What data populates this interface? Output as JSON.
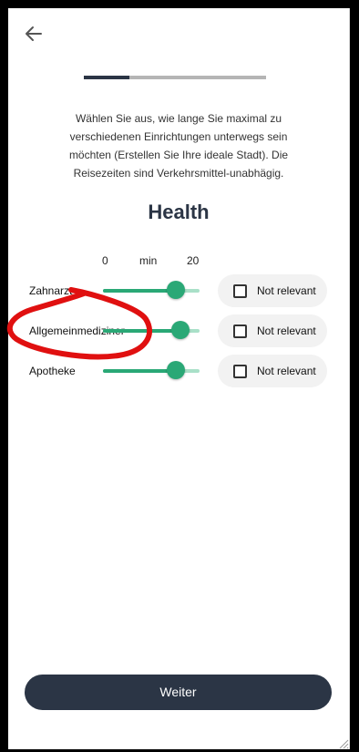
{
  "header": {
    "back_icon": "arrow-left-icon"
  },
  "progress": {
    "value": 0.25
  },
  "intro_text": "Wählen Sie aus, wie lange Sie maximal zu verschiedenen Einrichtungen unterwegs sein möchten (Erstellen Sie Ihre ideale Stadt). Die Reisezeiten sind Verkehrsmittel-unabhägig.",
  "section_title": "Health",
  "scale": {
    "min_value": "0",
    "unit": "min",
    "max_value": "20"
  },
  "rows": [
    {
      "label": "Zahnarzt",
      "value_fraction": 0.75,
      "checkbox_label": "Not relevant",
      "checked": false
    },
    {
      "label": "Allgemeinmediziner",
      "value_fraction": 0.8,
      "checkbox_label": "Not relevant",
      "checked": false
    },
    {
      "label": "Apotheke",
      "value_fraction": 0.75,
      "checkbox_label": "Not relevant",
      "checked": false
    }
  ],
  "next_button": {
    "label": "Weiter"
  },
  "colors": {
    "primary": "#2b3545",
    "accent": "#2aa876",
    "accent_light": "#a9e0c8",
    "annotation": "#e01010"
  }
}
